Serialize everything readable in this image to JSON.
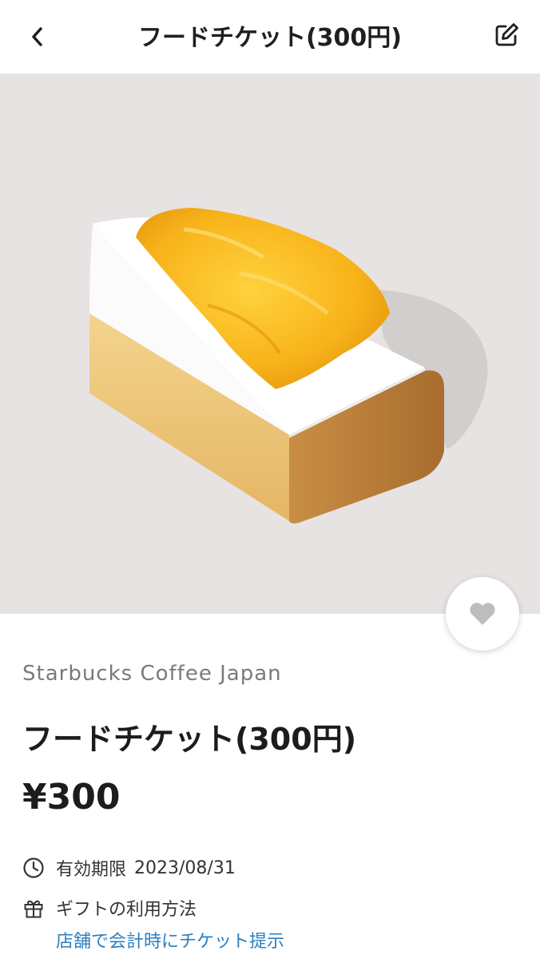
{
  "header": {
    "title": "フードチケット(300円)"
  },
  "icons": {
    "back": "chevron-left-icon",
    "edit": "edit-pencil-icon",
    "favorite": "heart-icon",
    "expiry": "clock-icon",
    "gift": "gift-icon"
  },
  "product": {
    "brand": "Starbucks Coffee Japan",
    "name": "フードチケット(300円)",
    "price": "¥300"
  },
  "details": {
    "expiry_label": "有効期限",
    "expiry_date": "2023/08/31",
    "gift_usage_label": "ギフトの利用方法",
    "gift_usage_link": "店舗で会計時にチケット提示"
  },
  "colors": {
    "hero_background": "#e6e3e2",
    "link": "#2b7fc0",
    "favorite_icon": "#bdbdbd"
  }
}
